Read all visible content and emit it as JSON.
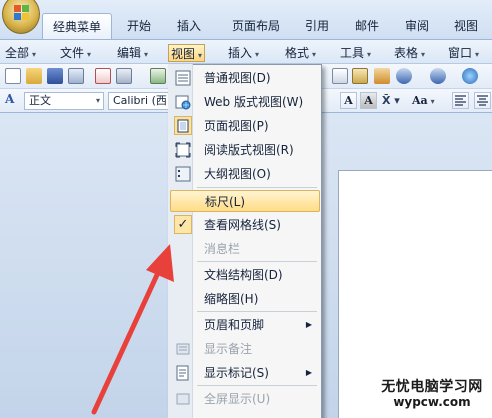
{
  "ribbon_tabs": [
    {
      "label": "经典菜单",
      "active": true
    },
    {
      "label": "开始"
    },
    {
      "label": "插入"
    },
    {
      "label": "页面布局"
    },
    {
      "label": "引用"
    },
    {
      "label": "邮件"
    },
    {
      "label": "审阅"
    },
    {
      "label": "视图"
    }
  ],
  "menubar": [
    {
      "label": "全部",
      "caret": "▾"
    },
    {
      "label": "文件",
      "caret": "▾"
    },
    {
      "label": "编辑",
      "caret": "▾"
    },
    {
      "label": "视图",
      "caret": "▾"
    },
    {
      "label": "插入",
      "caret": "▾"
    },
    {
      "label": "格式",
      "caret": "▾"
    },
    {
      "label": "工具",
      "caret": "▾"
    },
    {
      "label": "表格",
      "caret": "▾"
    },
    {
      "label": "窗口",
      "caret": "▾"
    }
  ],
  "toolbar2": {
    "style_value": "正文",
    "font_value": "Calibri (西",
    "bold_a": "A",
    "shade_a": "A",
    "case_aa": "Aa"
  },
  "view_menu": {
    "items": [
      {
        "label": "普通视图(D)"
      },
      {
        "label": "Web 版式视图(W)"
      },
      {
        "label": "页面视图(P)"
      },
      {
        "label": "阅读版式视图(R)"
      },
      {
        "label": "大纲视图(O)"
      },
      {
        "label": "标尺(L)"
      },
      {
        "label": "查看网格线(S)",
        "checkmark": "✓"
      },
      {
        "label": "消息栏"
      },
      {
        "label": "文档结构图(D)"
      },
      {
        "label": "缩略图(H)"
      },
      {
        "label": "页眉和页脚",
        "arrow": "▶"
      },
      {
        "label": "显示备注"
      },
      {
        "label": "显示标记(S)",
        "arrow": "▶"
      },
      {
        "label": "全屏显示(U)"
      }
    ]
  },
  "watermark": {
    "line1": "无忧电脑学习网",
    "line2": "wypcw.com"
  },
  "colors": {
    "accent_arrow": "#e8403a",
    "hover": "#ffdc86",
    "ribbon": "#cfdff2"
  }
}
